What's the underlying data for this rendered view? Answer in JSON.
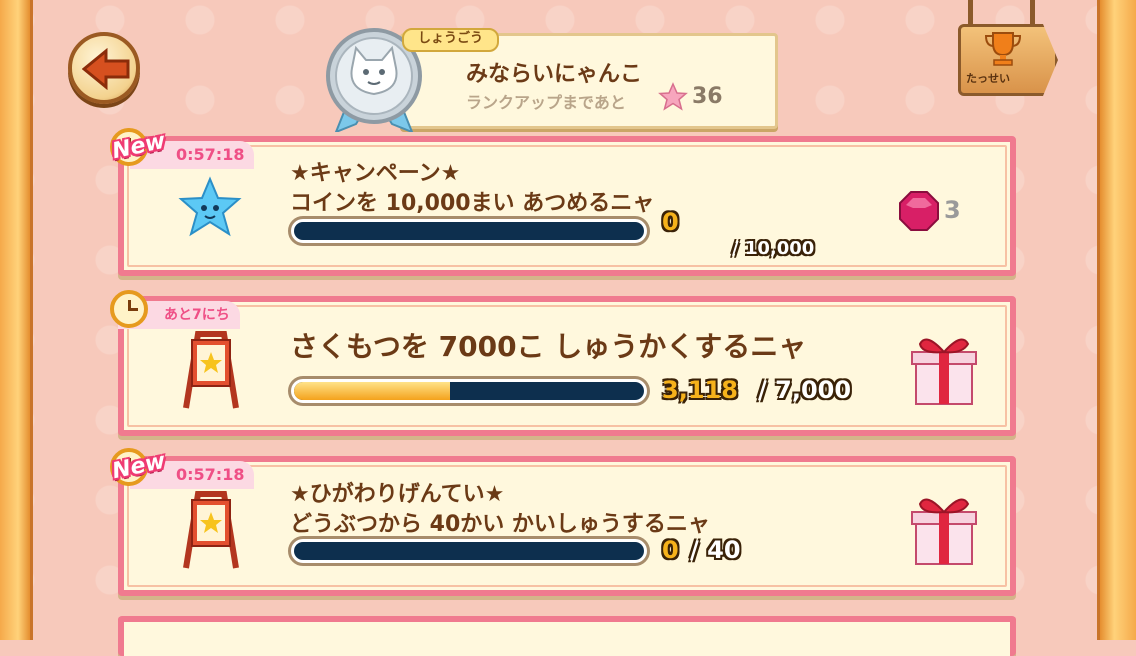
{
  "header": {
    "title_tag": "しょうごう",
    "title_name": "みならいにゃんこ",
    "rankup_text": "ランクアップまであと",
    "rankup_stars": "36",
    "achievement_label": "たっせい"
  },
  "missions": [
    {
      "badge": "New",
      "timer": "0:57:18",
      "title": "★キャンペーン★",
      "desc": "コインを 10,000まい あつめるニャ",
      "current": "0",
      "total": "/ 10,000",
      "progress": 0.0,
      "reward_icon": "red-gem-icon",
      "reward_count": "3"
    },
    {
      "badge": "",
      "timer": "あと7にち",
      "title": "",
      "desc": "さくもつを 7000こ しゅうかくするニャ",
      "current": "3,118",
      "total": "/ 7,000",
      "progress": 0.445,
      "reward_icon": "gift-box-icon",
      "reward_count": ""
    },
    {
      "badge": "New",
      "timer": "0:57:18",
      "title": "★ひがわりげんてい★",
      "desc": "どうぶつから 40かい かいしゅうするニャ",
      "current": "0",
      "total": "/ 40",
      "progress": 0.0,
      "reward_icon": "gift-box-icon",
      "reward_count": ""
    }
  ],
  "colors": {
    "card_border": "#f07a8f",
    "bar_track": "#0d2f4e",
    "bar_fill": "#f4a21c",
    "timer_text": "#ef4f86"
  }
}
